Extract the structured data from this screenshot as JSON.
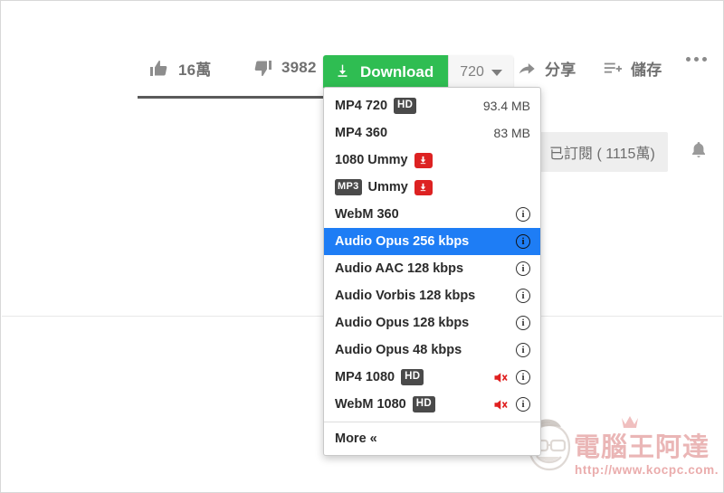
{
  "actions": {
    "like": {
      "icon": "thumbs-up-icon",
      "count": "16萬"
    },
    "dislike": {
      "icon": "thumbs-down-icon",
      "count": "3982"
    },
    "share": {
      "icon": "share-arrow-icon",
      "label": "分享"
    },
    "save": {
      "icon": "playlist-add-icon",
      "label": "儲存"
    },
    "more": {
      "icon": "ellipsis-icon"
    }
  },
  "download_button": {
    "label": "Download",
    "icon": "download-arrow-icon",
    "quality": "720",
    "caret": "chevron-down-icon",
    "color": "#2fbd52"
  },
  "subscribe": {
    "label": "已訂閱 ( 1115萬)",
    "bell_icon": "bell-icon"
  },
  "menu": {
    "more_label": "More «",
    "selected_color": "#1e7df5",
    "items": [
      {
        "label": "MP4 720",
        "badge": "HD",
        "size": "93.4 MB",
        "info": false,
        "muted": false,
        "ummy": false,
        "selected": false
      },
      {
        "label": "MP4 360",
        "badge": "",
        "size": "83 MB",
        "info": false,
        "muted": false,
        "ummy": false,
        "selected": false
      },
      {
        "label": "1080 Ummy",
        "badge": "",
        "size": "",
        "info": false,
        "muted": false,
        "ummy": true,
        "selected": false
      },
      {
        "label": "Ummy",
        "badge": "MP3",
        "badge_before": true,
        "size": "",
        "info": false,
        "muted": false,
        "ummy": true,
        "selected": false
      },
      {
        "label": "WebM 360",
        "badge": "",
        "size": "",
        "info": true,
        "muted": false,
        "ummy": false,
        "selected": false
      },
      {
        "label": "Audio Opus 256 kbps",
        "badge": "",
        "size": "",
        "info": true,
        "muted": false,
        "ummy": false,
        "selected": true
      },
      {
        "label": "Audio AAC 128 kbps",
        "badge": "",
        "size": "",
        "info": true,
        "muted": false,
        "ummy": false,
        "selected": false
      },
      {
        "label": "Audio Vorbis 128 kbps",
        "badge": "",
        "size": "",
        "info": true,
        "muted": false,
        "ummy": false,
        "selected": false
      },
      {
        "label": "Audio Opus 128 kbps",
        "badge": "",
        "size": "",
        "info": true,
        "muted": false,
        "ummy": false,
        "selected": false
      },
      {
        "label": "Audio Opus 48 kbps",
        "badge": "",
        "size": "",
        "info": true,
        "muted": false,
        "ummy": false,
        "selected": false
      },
      {
        "label": "MP4 1080",
        "badge": "HD",
        "size": "",
        "info": true,
        "muted": true,
        "ummy": false,
        "selected": false
      },
      {
        "label": "WebM 1080",
        "badge": "HD",
        "size": "",
        "info": true,
        "muted": true,
        "ummy": false,
        "selected": false
      }
    ]
  },
  "watermark": {
    "title": "電腦王阿達",
    "url": "http://www.kocpc.com.tw"
  }
}
